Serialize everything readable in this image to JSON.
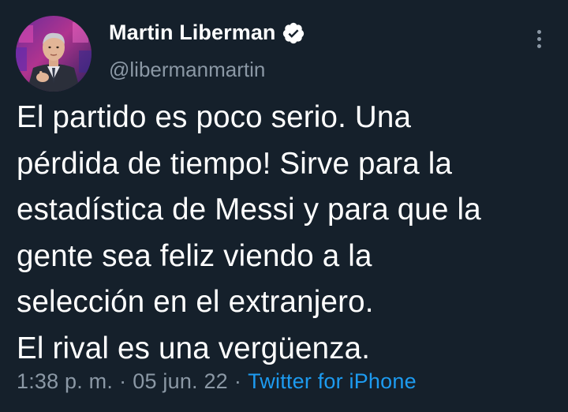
{
  "author": {
    "name": "Martin Liberman",
    "handle": "@libermanmartin",
    "verified": true,
    "verified_icon": "verified-badge-icon"
  },
  "menu": {
    "icon": "more-options-icon"
  },
  "tweet": {
    "lines": [
      "El partido es poco serio. Una",
      "pérdida de tiempo! Sirve para la",
      "estadística de Messi y para que la",
      "gente sea feliz viendo a la",
      "selección en el extranjero.",
      "El rival es una vergüenza."
    ]
  },
  "meta": {
    "time": "1:38 p. m.",
    "separator": "·",
    "date": "05 jun. 22",
    "source": "Twitter for iPhone"
  },
  "colors": {
    "background": "#15202b",
    "text": "#ffffff",
    "secondary": "#8b98a5",
    "accent": "#1d9bf0"
  }
}
